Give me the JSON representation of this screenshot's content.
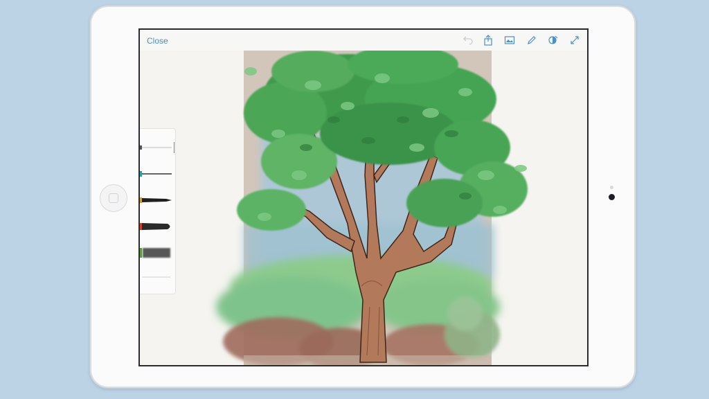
{
  "topbar": {
    "close_label": "Close",
    "tools": [
      {
        "icon": "undo-icon",
        "color": "#c9cdd1"
      },
      {
        "icon": "share-icon",
        "color": "#4a90c8"
      },
      {
        "icon": "image-icon",
        "color": "#4a90c8"
      },
      {
        "icon": "pencil-icon",
        "color": "#4a90c8"
      },
      {
        "icon": "layers-icon",
        "color": "#4a90c8"
      },
      {
        "icon": "expand-icon",
        "color": "#4a90c8"
      }
    ]
  },
  "brushes": [
    {
      "icon": "thin-pen-brush-icon",
      "selected": true
    },
    {
      "icon": "fine-line-brush-icon",
      "selected": false
    },
    {
      "icon": "tapered-ink-brush-icon",
      "selected": false
    },
    {
      "icon": "marker-brush-icon",
      "selected": false
    },
    {
      "icon": "watercolor-brush-icon",
      "selected": false
    },
    {
      "icon": "eraser-brush-icon",
      "selected": false
    }
  ],
  "colors": {
    "accent": "#4a90c8",
    "screen_border": "#2a2b2e",
    "paper": "#f5f4f0"
  }
}
